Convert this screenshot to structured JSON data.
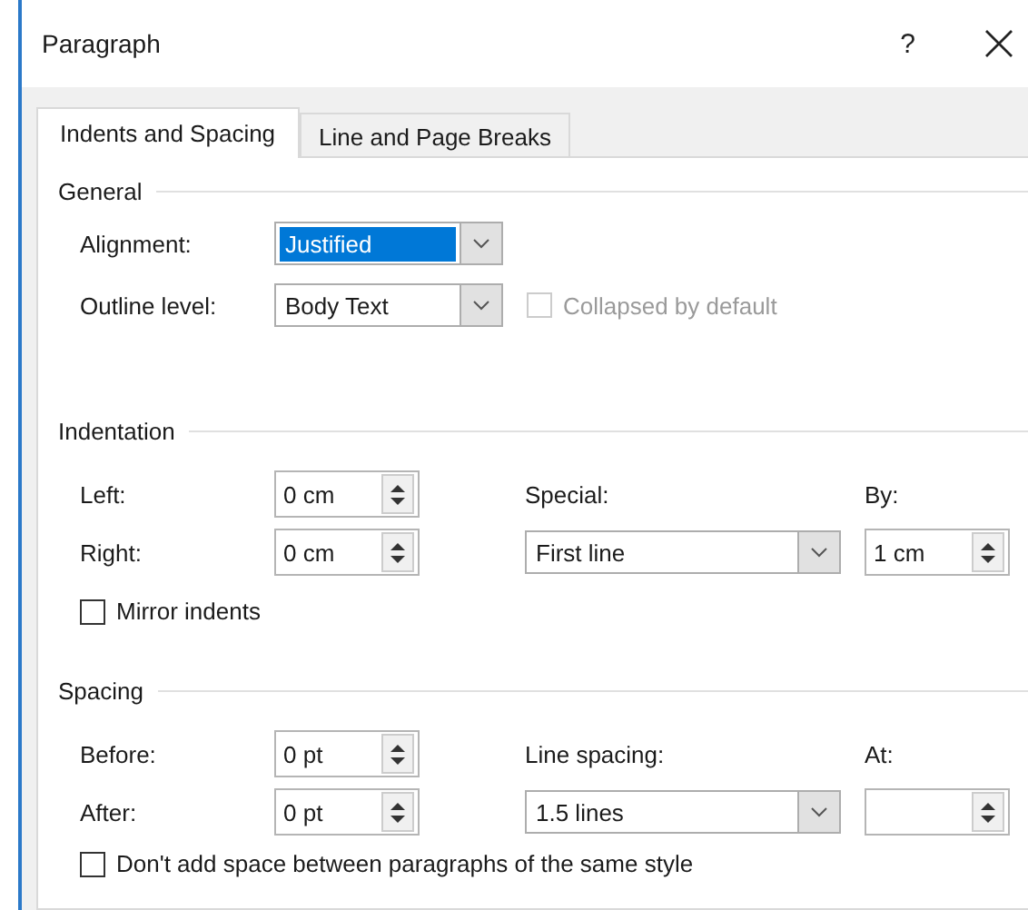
{
  "window": {
    "title": "Paragraph",
    "help": "?"
  },
  "tabs": [
    {
      "label": "Indents and Spacing",
      "selected": true
    },
    {
      "label": "Line and Page Breaks",
      "selected": false
    }
  ],
  "general": {
    "title": "General",
    "alignment": {
      "label": "Alignment:",
      "value": "Justified",
      "highlighted": true
    },
    "outline_level": {
      "label": "Outline level:",
      "value": "Body Text",
      "highlighted": false
    },
    "collapsed": {
      "label": "Collapsed by default",
      "checked": false,
      "disabled": true
    }
  },
  "indentation": {
    "title": "Indentation",
    "left": {
      "label": "Left:",
      "value": "0 cm"
    },
    "right": {
      "label": "Right:",
      "value": "0 cm"
    },
    "special": {
      "label": "Special:",
      "value": "First line"
    },
    "by": {
      "label": "By:",
      "value": "1 cm"
    },
    "mirror": {
      "label": "Mirror indents",
      "checked": false,
      "disabled": false
    }
  },
  "spacing": {
    "title": "Spacing",
    "before": {
      "label": "Before:",
      "value": "0 pt"
    },
    "after": {
      "label": "After:",
      "value": "0 pt"
    },
    "line_spacing": {
      "label": "Line spacing:",
      "value": "1.5 lines"
    },
    "at": {
      "label": "At:"
    },
    "dont_add": {
      "label": "Don't add space between paragraphs of the same style",
      "checked": false,
      "disabled": false
    }
  }
}
